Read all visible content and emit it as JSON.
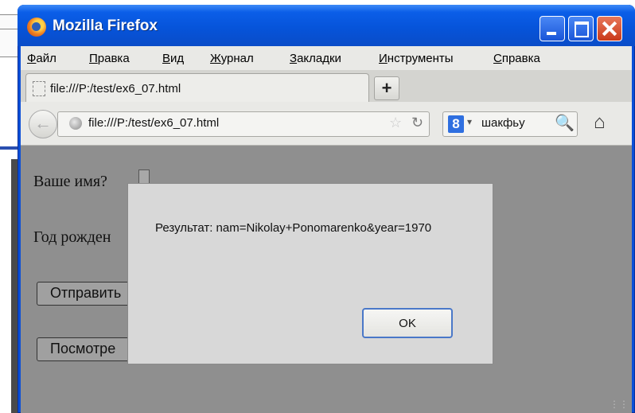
{
  "window": {
    "title": "Mozilla Firefox"
  },
  "menu": [
    "Файл",
    "Правка",
    "Вид",
    "Журнал",
    "Закладки",
    "Инструменты",
    "Справка"
  ],
  "tab": {
    "label": "file:///P:/test/ex6_07.html",
    "new_tab": "+"
  },
  "navbar": {
    "url": "file:///P:/test/ex6_07.html",
    "search_engine": "8",
    "search_query": "шакфьу"
  },
  "page": {
    "name_label": "Ваше имя?",
    "year_label": "Год рожден",
    "submit_button": "Отправить",
    "view_button": "Посмотре"
  },
  "dialog": {
    "message": "Результат: nam=Nikolay+Ponomarenko&year=1970",
    "ok_label": "OK"
  }
}
